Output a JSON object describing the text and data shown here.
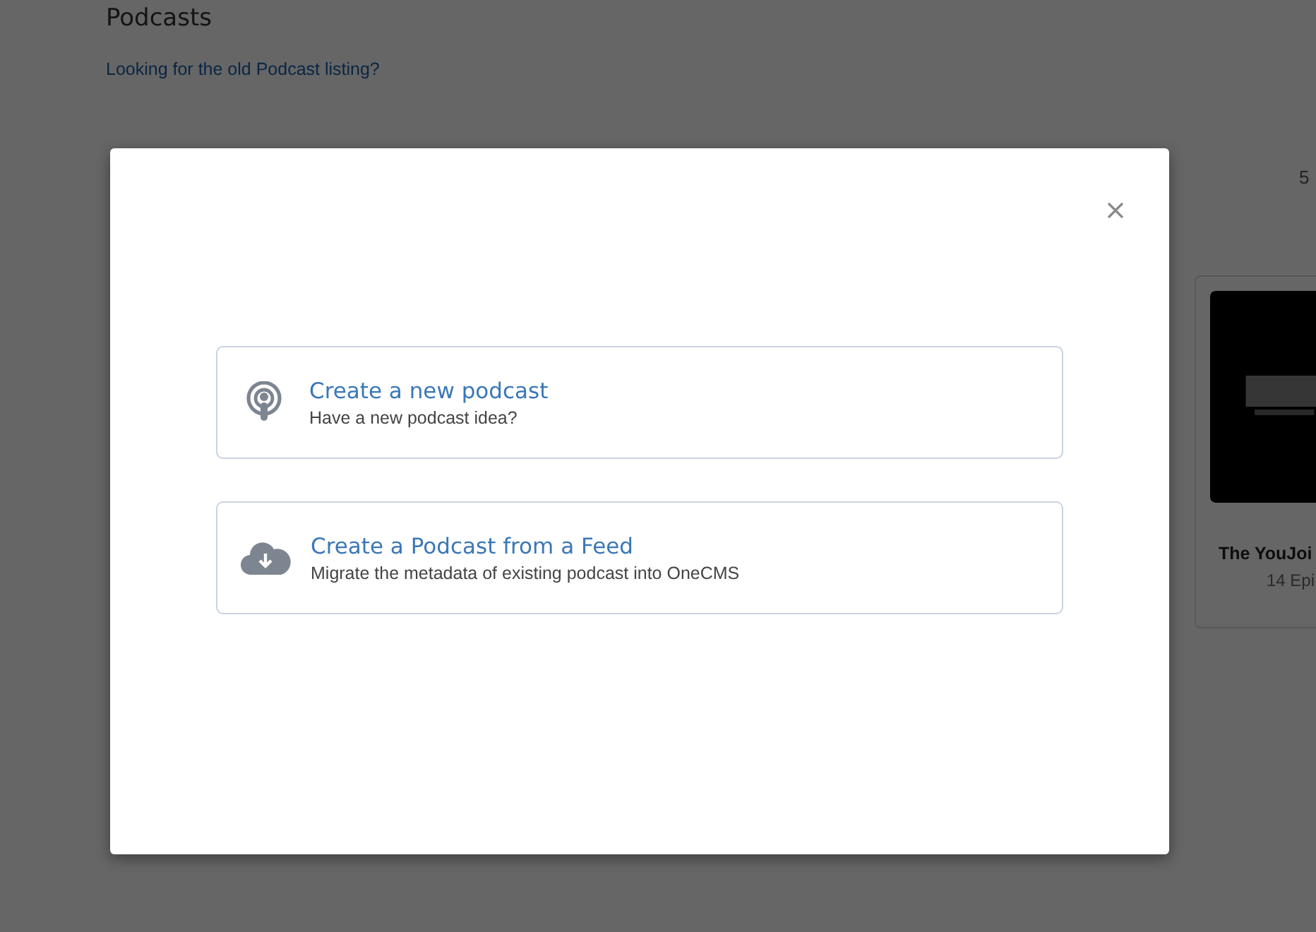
{
  "page": {
    "title": "Podcasts",
    "old_listing_link": "Looking for the old Podcast listing?",
    "count": "5"
  },
  "podcast_card": {
    "title": "The YouJoi",
    "episodes": "14 Epi"
  },
  "modal": {
    "options": [
      {
        "kind": "podcast",
        "title": "Create a new podcast",
        "description": "Have a new podcast idea?"
      },
      {
        "kind": "feed",
        "title": "Create a Podcast from a Feed",
        "description": "Migrate the metadata of existing podcast into OneCMS"
      }
    ]
  }
}
